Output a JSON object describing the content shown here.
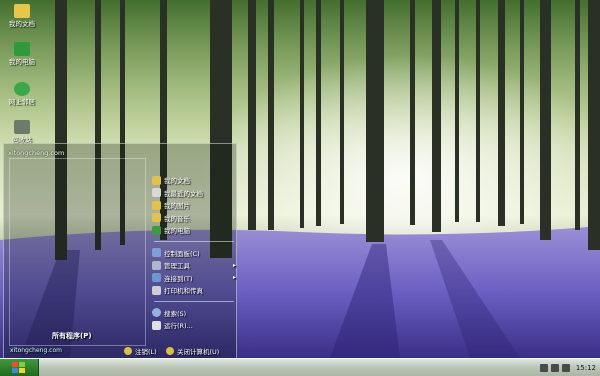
{
  "colors": {
    "accent": "#2e8b2a",
    "menu_border": "#dcebdc",
    "taskbar": "#c4cec0",
    "flowers": "#6a5fc6"
  },
  "desktop": {
    "icons": [
      {
        "label": "我的文档",
        "icon": "folder-icon"
      },
      {
        "label": "我的电脑",
        "icon": "computer-icon"
      },
      {
        "label": "网上邻居",
        "icon": "network-icon"
      },
      {
        "label": "回收站",
        "icon": "recycle-bin-icon"
      }
    ]
  },
  "start_menu": {
    "user": "xitongcheng.com",
    "all_programs": "所有程序(P)",
    "footer": "xitongcheng.com",
    "right_items": [
      {
        "label": "我的文档",
        "icon": "folder-icon"
      },
      {
        "label": "我最近的文档",
        "icon": "recent-docs-icon"
      },
      {
        "label": "我的图片",
        "icon": "pictures-icon"
      },
      {
        "label": "我的音乐",
        "icon": "music-icon"
      },
      {
        "label": "我的电脑",
        "icon": "computer-icon"
      }
    ],
    "right_items_2": [
      {
        "label": "控制面板(C)",
        "icon": "control-panel-icon"
      },
      {
        "label": "管理工具",
        "icon": "admin-tools-icon",
        "arrow": "▸"
      },
      {
        "label": "连接到(T)",
        "icon": "connect-icon",
        "arrow": "▸"
      },
      {
        "label": "打印机和传真",
        "icon": "printer-icon"
      }
    ],
    "right_items_3": [
      {
        "label": "搜索(S)",
        "icon": "search-icon"
      },
      {
        "label": "运行(R)...",
        "icon": "run-icon"
      }
    ],
    "logoff": "注销(L)",
    "shutdown": "关闭计算机(U)"
  },
  "taskbar": {
    "clock": "15:12"
  }
}
